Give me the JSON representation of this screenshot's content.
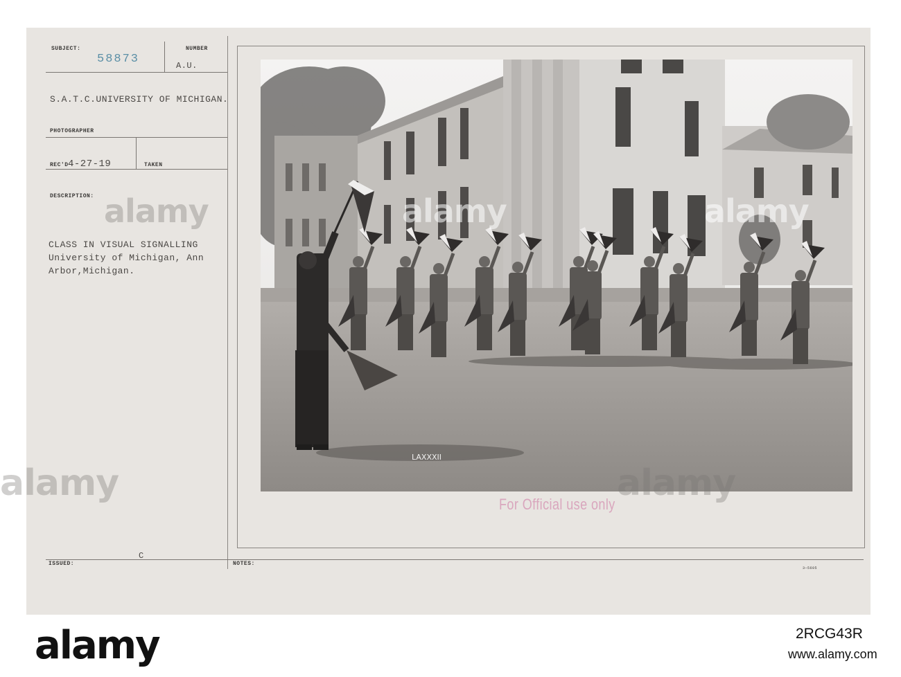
{
  "card": {
    "subject_label": "SUBJECT:",
    "subject_number": "58873",
    "number_label": "NUMBER",
    "number_value": "A.U.",
    "unit_line": "S.A.T.C.UNIVERSITY OF MICHIGAN.",
    "photographer_label": "PHOTOGRAPHER",
    "recd_label": "REC'D",
    "recd_value": "4-27-19",
    "taken_label": "TAKEN",
    "description_label": "DESCRIPTION:",
    "description_lines": [
      "CLASS IN VISUAL SIGNALLING",
      "University of Michigan, Ann",
      "Arbor,Michigan."
    ],
    "issued_label": "ISSUED:",
    "issued_value": "C",
    "notes_label": "NOTES:",
    "form_number": "3—5605",
    "stamp": "For Official use only"
  },
  "photo": {
    "negative_mark": "LAXXXII"
  },
  "watermark": {
    "text": "alamy",
    "footer_id": "2RCG43R",
    "footer_url": "www.alamy.com"
  }
}
